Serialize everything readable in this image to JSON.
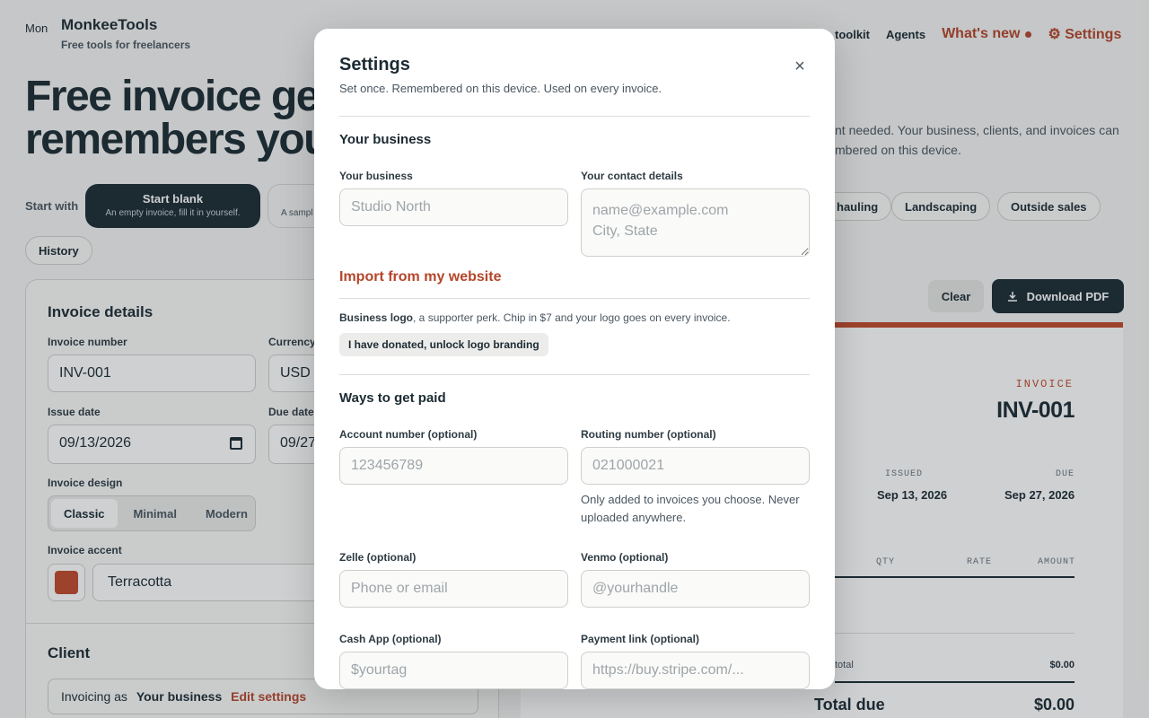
{
  "brand": {
    "logo_alt": "Mon",
    "name": "MonkeeTools",
    "tagline": "Free tools for freelancers"
  },
  "nav": {
    "toolkit": "toolkit",
    "agents": "Agents",
    "whats_new": "What's new",
    "settings": "⚙ Settings"
  },
  "hero": {
    "line1": "Free invoice gen",
    "line2": "remembers you",
    "right_line1": "nt needed. Your business, clients, and invoices can",
    "right_line2": "mbered on this device."
  },
  "start": {
    "label": "Start with",
    "blank_title": "Start blank",
    "blank_sub": "An empty invoice, fill it in yourself.",
    "sample_sub": "A sampl",
    "chips": [
      "hauling",
      "Landscaping",
      "Outside sales"
    ],
    "history": "History"
  },
  "invoice_details": {
    "title": "Invoice details",
    "number_label": "Invoice number",
    "number_value": "INV-001",
    "currency_label": "Currency",
    "currency_value": "USD",
    "issue_label": "Issue date",
    "issue_value": "09/13/2026",
    "due_label": "Due date",
    "due_value": "09/27",
    "design_label": "Invoice design",
    "designs": [
      "Classic",
      "Minimal",
      "Modern"
    ],
    "design_active": "Classic",
    "accent_label": "Invoice accent",
    "accent_value": "Terracotta",
    "accent_color": "#c0492b"
  },
  "client": {
    "title": "Client",
    "invoicing_as": "Invoicing as",
    "business": "Your business",
    "edit": "Edit settings"
  },
  "actions": {
    "clear": "Clear",
    "download": "Download PDF"
  },
  "preview": {
    "label": "INVOICE",
    "number": "INV-001",
    "issued_label": "ISSUED",
    "issued": "Sep 13, 2026",
    "due_label": "DUE",
    "due": "Sep 27, 2026",
    "cols": [
      "QTY",
      "RATE",
      "AMOUNT"
    ],
    "subtotal_label": "total",
    "subtotal": "$0.00",
    "total_label": "Total due",
    "total": "$0.00"
  },
  "modal": {
    "title": "Settings",
    "subtitle": "Set once. Remembered on this device. Used on every invoice.",
    "close": "×",
    "section_business": "Your business",
    "business_label": "Your business",
    "business_placeholder": "Studio North",
    "contact_label": "Your contact details",
    "contact_placeholder": "name@example.com\nCity, State",
    "import": "Import from my website",
    "logo_bold": "Business logo",
    "logo_rest": ", a supporter perk. Chip in $7 and your logo goes on every invoice.",
    "donate": "I have donated, unlock logo branding",
    "section_paid": "Ways to get paid",
    "account_label": "Account number (optional)",
    "account_placeholder": "123456789",
    "routing_label": "Routing number (optional)",
    "routing_placeholder": "021000021",
    "routing_help": "Only added to invoices you choose. Never uploaded anywhere.",
    "zelle_label": "Zelle (optional)",
    "zelle_placeholder": "Phone or email",
    "venmo_label": "Venmo (optional)",
    "venmo_placeholder": "@yourhandle",
    "cashapp_label": "Cash App (optional)",
    "cashapp_placeholder": "$yourtag",
    "paylink_label": "Payment link (optional)",
    "paylink_placeholder": "https://buy.stripe.com/..."
  }
}
